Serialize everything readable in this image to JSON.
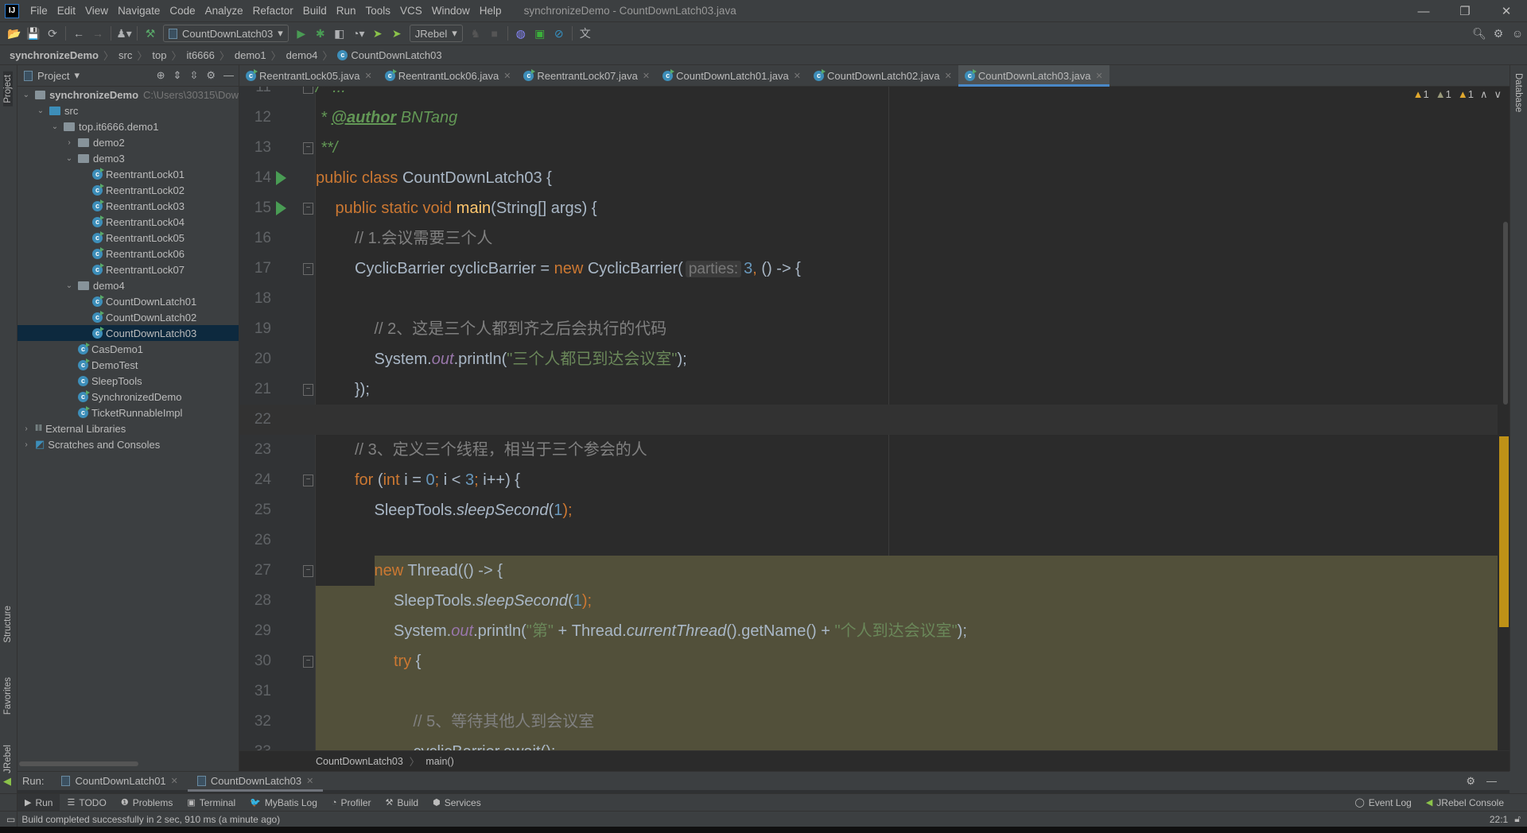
{
  "window": {
    "title": "synchronizeDemo - CountDownLatch03.java",
    "logo": "IJ",
    "controls": [
      "minimize-icon",
      "restore-icon",
      "close-icon"
    ]
  },
  "menu": [
    "File",
    "Edit",
    "View",
    "Navigate",
    "Code",
    "Analyze",
    "Refactor",
    "Build",
    "Run",
    "Tools",
    "VCS",
    "Window",
    "Help"
  ],
  "toolbar": {
    "run_config": "CountDownLatch03",
    "jrebel": "JRebel"
  },
  "breadcrumb": [
    "synchronizeDemo",
    "src",
    "top",
    "it6666",
    "demo1",
    "demo4",
    "CountDownLatch03"
  ],
  "project": {
    "title": "Project",
    "root": "synchronizeDemo",
    "root_path": "C:\\Users\\30315\\Dow",
    "tree": [
      {
        "label": "synchronizeDemo",
        "depth": 0,
        "type": "module",
        "expanded": true
      },
      {
        "label": "src",
        "depth": 1,
        "type": "src",
        "expanded": true
      },
      {
        "label": "top.it6666.demo1",
        "depth": 2,
        "type": "package",
        "expanded": true
      },
      {
        "label": "demo2",
        "depth": 3,
        "type": "package",
        "expanded": false
      },
      {
        "label": "demo3",
        "depth": 3,
        "type": "package",
        "expanded": true
      },
      {
        "label": "ReentrantLock01",
        "depth": 4,
        "type": "class"
      },
      {
        "label": "ReentrantLock02",
        "depth": 4,
        "type": "class"
      },
      {
        "label": "ReentrantLock03",
        "depth": 4,
        "type": "class"
      },
      {
        "label": "ReentrantLock04",
        "depth": 4,
        "type": "class"
      },
      {
        "label": "ReentrantLock05",
        "depth": 4,
        "type": "class"
      },
      {
        "label": "ReentrantLock06",
        "depth": 4,
        "type": "class"
      },
      {
        "label": "ReentrantLock07",
        "depth": 4,
        "type": "class"
      },
      {
        "label": "demo4",
        "depth": 3,
        "type": "package",
        "expanded": true
      },
      {
        "label": "CountDownLatch01",
        "depth": 4,
        "type": "class"
      },
      {
        "label": "CountDownLatch02",
        "depth": 4,
        "type": "class"
      },
      {
        "label": "CountDownLatch03",
        "depth": 4,
        "type": "class",
        "selected": true
      },
      {
        "label": "CasDemo1",
        "depth": 3,
        "type": "class"
      },
      {
        "label": "DemoTest",
        "depth": 3,
        "type": "class"
      },
      {
        "label": "SleepTools",
        "depth": 3,
        "type": "class"
      },
      {
        "label": "SynchronizedDemo",
        "depth": 3,
        "type": "class"
      },
      {
        "label": "TicketRunnableImpl",
        "depth": 3,
        "type": "class"
      },
      {
        "label": "External Libraries",
        "depth": 0,
        "type": "libs",
        "expanded": false
      },
      {
        "label": "Scratches and Consoles",
        "depth": 0,
        "type": "scratch",
        "expanded": false
      }
    ]
  },
  "tabs": [
    {
      "label": "ReentrantLock05.java"
    },
    {
      "label": "ReentrantLock06.java"
    },
    {
      "label": "ReentrantLock07.java"
    },
    {
      "label": "CountDownLatch01.java"
    },
    {
      "label": "CountDownLatch02.java"
    },
    {
      "label": "CountDownLatch03.java",
      "active": true
    }
  ],
  "warnings": [
    "1",
    "1",
    "1"
  ],
  "editor": {
    "current_line": 22,
    "highlight_from_line": 27,
    "run_lines": [
      14,
      15
    ],
    "fold_lines": [
      11,
      13,
      15,
      17,
      21,
      24,
      27,
      30
    ],
    "lines": [
      {
        "n": 11,
        "tokens": [
          [
            "/**...",
            "doc"
          ]
        ]
      },
      {
        "n": 12,
        "tokens": [
          [
            " * ",
            "doc"
          ],
          [
            "@author",
            "tag"
          ],
          [
            " BNTang",
            "doc"
          ]
        ]
      },
      {
        "n": 13,
        "tokens": [
          [
            " **/",
            "doc"
          ]
        ]
      },
      {
        "n": 14,
        "tokens": [
          [
            "public class ",
            "kw"
          ],
          [
            "CountDownLatch03 {",
            ""
          ]
        ]
      },
      {
        "n": 15,
        "tokens": [
          [
            "    public static void ",
            "kw"
          ],
          [
            "main",
            "mth"
          ],
          [
            "(String[] args) {",
            ""
          ]
        ]
      },
      {
        "n": 16,
        "tokens": [
          [
            "        // 1.会议需要三个人",
            "cm"
          ]
        ]
      },
      {
        "n": 17,
        "tokens": [
          [
            "        CyclicBarrier cyclicBarrier = ",
            ""
          ],
          [
            "new ",
            "kw"
          ],
          [
            "CyclicBarrier(",
            ""
          ],
          [
            "parties:",
            "hint"
          ],
          [
            "3",
            "num"
          ],
          [
            ", ",
            "kw"
          ],
          [
            "() -> {",
            ""
          ]
        ]
      },
      {
        "n": 18,
        "tokens": []
      },
      {
        "n": 19,
        "tokens": [
          [
            "            // 2、这是三个人都到齐之后会执行的代码",
            "cm"
          ]
        ]
      },
      {
        "n": 20,
        "tokens": [
          [
            "            System.",
            ""
          ],
          [
            "out",
            "fld"
          ],
          [
            ".println(",
            ""
          ],
          [
            "\"三个人都已到达会议室\"",
            "str"
          ],
          [
            ");",
            ""
          ]
        ]
      },
      {
        "n": 21,
        "tokens": [
          [
            "        });",
            ""
          ]
        ]
      },
      {
        "n": 22,
        "tokens": []
      },
      {
        "n": 23,
        "tokens": [
          [
            "        // 3、定义三个线程，相当于三个参会的人",
            "cm"
          ]
        ]
      },
      {
        "n": 24,
        "tokens": [
          [
            "        for ",
            "kw"
          ],
          [
            "(",
            ""
          ],
          [
            "int ",
            "kw"
          ],
          [
            "i = ",
            ""
          ],
          [
            "0",
            "num"
          ],
          [
            "; ",
            "kw"
          ],
          [
            "i < ",
            ""
          ],
          [
            "3",
            "num"
          ],
          [
            "; ",
            "kw"
          ],
          [
            "i++) {",
            ""
          ]
        ]
      },
      {
        "n": 25,
        "tokens": [
          [
            "            SleepTools.",
            ""
          ],
          [
            "sleepSecond",
            "st"
          ],
          [
            "(",
            ""
          ],
          [
            "1",
            "num"
          ],
          [
            ");",
            "kw"
          ]
        ]
      },
      {
        "n": 26,
        "tokens": []
      },
      {
        "n": 27,
        "tokens": [
          [
            "            new ",
            "kw"
          ],
          [
            "Thread(() -> {",
            ""
          ]
        ]
      },
      {
        "n": 28,
        "tokens": [
          [
            "                SleepTools.",
            ""
          ],
          [
            "sleepSecond",
            "st"
          ],
          [
            "(",
            ""
          ],
          [
            "1",
            "num"
          ],
          [
            ");",
            "kw"
          ]
        ]
      },
      {
        "n": 29,
        "tokens": [
          [
            "                System.",
            ""
          ],
          [
            "out",
            "fld"
          ],
          [
            ".println(",
            ""
          ],
          [
            "\"第\"",
            "str"
          ],
          [
            " + Thread.",
            ""
          ],
          [
            "currentThread",
            "st"
          ],
          [
            "().getName() + ",
            ""
          ],
          [
            "\"个人到达会议室\"",
            "str"
          ],
          [
            ");",
            ""
          ]
        ]
      },
      {
        "n": 30,
        "tokens": [
          [
            "                try ",
            "kw"
          ],
          [
            "{",
            ""
          ]
        ]
      },
      {
        "n": 31,
        "tokens": []
      },
      {
        "n": 32,
        "tokens": [
          [
            "                    // 5、等待其他人到会议室",
            "cm"
          ]
        ]
      },
      {
        "n": 33,
        "tokens": [
          [
            "                    cyclicBarrier.await();",
            ""
          ]
        ]
      }
    ]
  },
  "editor_breadcrumb": [
    "CountDownLatch03",
    "main()"
  ],
  "run_panel": {
    "label": "Run:",
    "tabs": [
      {
        "label": "CountDownLatch01"
      },
      {
        "label": "CountDownLatch03",
        "active": true
      }
    ]
  },
  "tool_buttons": [
    {
      "label": "Run",
      "icon": "play-icon",
      "active": true
    },
    {
      "label": "TODO",
      "icon": "list-icon"
    },
    {
      "label": "Problems",
      "icon": "info-icon"
    },
    {
      "label": "Terminal",
      "icon": "terminal-icon"
    },
    {
      "label": "MyBatis Log",
      "icon": "mybatis-icon"
    },
    {
      "label": "Profiler",
      "icon": "profiler-icon"
    },
    {
      "label": "Build",
      "icon": "hammer-icon"
    },
    {
      "label": "Services",
      "icon": "services-icon"
    }
  ],
  "tool_buttons_right": [
    {
      "label": "Event Log",
      "icon": "event-log-icon"
    },
    {
      "label": "JRebel Console",
      "icon": "jrebel-icon"
    }
  ],
  "side_labels": {
    "left": [
      "Project",
      "Structure",
      "Favorites",
      "JRebel"
    ],
    "right": [
      "Database"
    ]
  },
  "status": {
    "message": "Build completed successfully in 2 sec, 910 ms (a minute ago)",
    "position": "22:1"
  },
  "colors": {
    "accent": "#4A88C7",
    "keyword": "#CC7832",
    "comment": "#808080",
    "string": "#6A8759",
    "number": "#6897BB",
    "highlight": "#52503A"
  }
}
